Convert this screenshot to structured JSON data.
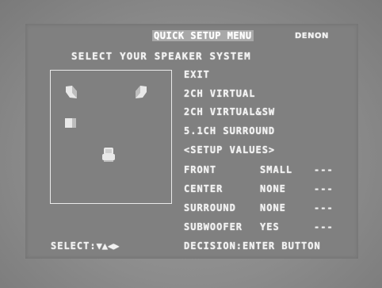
{
  "header": {
    "menu_title": "QUICK SETUP MENU",
    "brand": "DENON"
  },
  "subtitle": "SELECT YOUR SPEAKER SYSTEM",
  "menu": {
    "exit": "EXIT",
    "virtual_2ch": "2CH VIRTUAL",
    "virtual_2ch_sw": "2CH VIRTUAL&SW",
    "surround_51": "5.1CH SURROUND",
    "setup_values": "<SETUP VALUES>"
  },
  "settings": [
    {
      "label": "FRONT",
      "value": "SMALL",
      "extra": "---"
    },
    {
      "label": "CENTER",
      "value": "NONE",
      "extra": "---"
    },
    {
      "label": "SURROUND",
      "value": "NONE",
      "extra": "---"
    },
    {
      "label": "SUBWOOFER",
      "value": "YES",
      "extra": "---"
    }
  ],
  "footer": {
    "select_label": "SELECT:",
    "arrows": "▼▲◀▶",
    "decision": "DECISION:ENTER BUTTON"
  },
  "icons": {
    "front_left": "speaker-front-left-icon",
    "front_right": "speaker-front-right-icon",
    "surround_left": "speaker-surround-left-icon",
    "listener": "listener-seat-icon"
  }
}
